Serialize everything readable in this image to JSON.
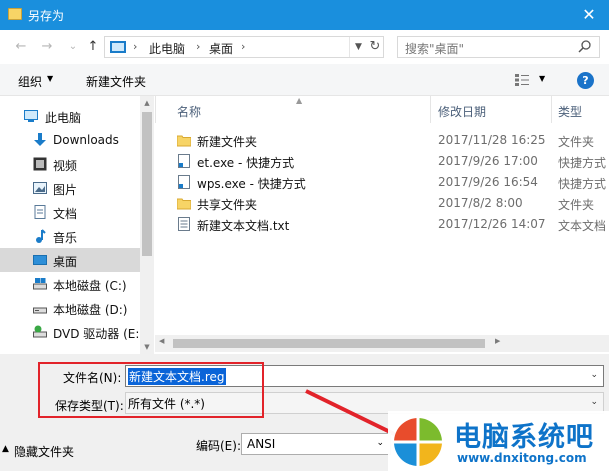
{
  "window": {
    "title": "另存为",
    "close_glyph": "✕"
  },
  "nav_buttons": {
    "back": "←",
    "forward": "→",
    "recent": "⌄",
    "up": "↑"
  },
  "address": {
    "crumbs": [
      "此电脑",
      "桌面"
    ],
    "separator": "›",
    "refresh_glyph": "↻"
  },
  "search": {
    "placeholder": "搜索\"桌面\""
  },
  "toolbar": {
    "organize_label": "组织",
    "new_folder_label": "新建文件夹",
    "help_glyph": "?"
  },
  "sidebar": {
    "items": [
      {
        "label": "此电脑",
        "icon": "computer-icon"
      },
      {
        "label": "Downloads",
        "icon": "download-icon"
      },
      {
        "label": "视频",
        "icon": "video-icon"
      },
      {
        "label": "图片",
        "icon": "picture-icon"
      },
      {
        "label": "文档",
        "icon": "document-icon"
      },
      {
        "label": "音乐",
        "icon": "music-icon"
      },
      {
        "label": "桌面",
        "icon": "desktop-icon",
        "selected": true
      },
      {
        "label": "本地磁盘 (C:)",
        "icon": "drive-icon"
      },
      {
        "label": "本地磁盘 (D:)",
        "icon": "drive-icon"
      },
      {
        "label": "DVD 驱动器 (E:)",
        "icon": "dvd-icon"
      }
    ]
  },
  "file_list": {
    "columns": [
      "名称",
      "修改日期",
      "类型"
    ],
    "rows": [
      {
        "name": "新建文件夹",
        "date": "2017/11/28 16:25",
        "type": "文件夹",
        "icon": "folder-icon"
      },
      {
        "name": "et.exe - 快捷方式",
        "date": "2017/9/26 17:00",
        "type": "快捷方式",
        "icon": "shortcut-icon"
      },
      {
        "name": "wps.exe - 快捷方式",
        "date": "2017/9/26 16:54",
        "type": "快捷方式",
        "icon": "shortcut-icon"
      },
      {
        "name": "共享文件夹",
        "date": "2017/8/2 8:00",
        "type": "文件夹",
        "icon": "folder-icon"
      },
      {
        "name": "新建文本文档.txt",
        "date": "2017/12/26 14:07",
        "type": "文本文档",
        "icon": "text-file-icon"
      }
    ]
  },
  "form": {
    "filename_label": "文件名(N):",
    "filename_value": "新建文本文档.reg",
    "filetype_label": "保存类型(T):",
    "filetype_value": "所有文件  (*.*)"
  },
  "footer": {
    "hide_folders_label": "隐藏文件夹",
    "encoding_label": "编码(E):",
    "encoding_value": "ANSI"
  },
  "watermark": {
    "title": "电脑系统吧",
    "url": "www.dnxitong.com"
  },
  "colors": {
    "titlebar": "#1a8fdd",
    "selection": "#0a64d8",
    "annotation_red": "#e2232a",
    "brand_blue": "#0e73c9"
  }
}
